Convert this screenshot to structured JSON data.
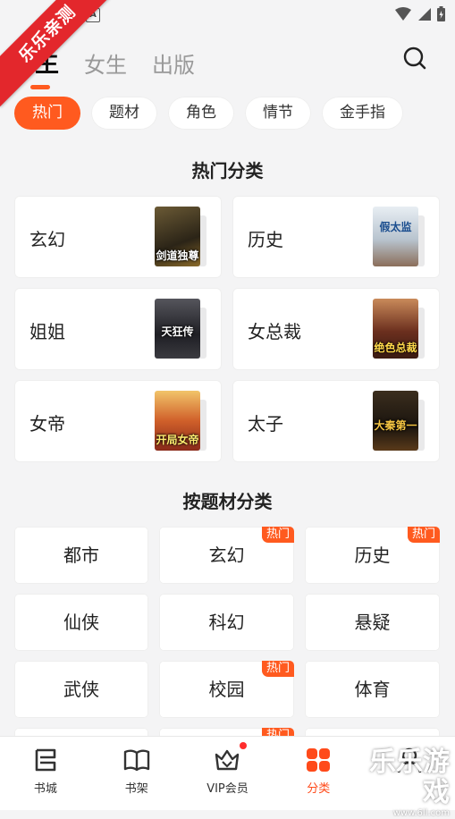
{
  "watermark_ribbon": "乐乐亲测",
  "watermark_corner": {
    "title": "乐乐游戏",
    "url": "www.6ll.com"
  },
  "top_tabs": [
    {
      "label": "男生",
      "active": true
    },
    {
      "label": "女生",
      "active": false
    },
    {
      "label": "出版",
      "active": false
    }
  ],
  "chips": [
    {
      "label": "热门",
      "active": true
    },
    {
      "label": "题材",
      "active": false
    },
    {
      "label": "角色",
      "active": false
    },
    {
      "label": "情节",
      "active": false
    },
    {
      "label": "金手指",
      "active": false
    }
  ],
  "hot_section": {
    "title": "热门分类",
    "items": [
      {
        "label": "玄幻",
        "cover_text": "剑道独尊",
        "cover_color": "#3a3325"
      },
      {
        "label": "历史",
        "cover_text": "假太监",
        "cover_color": "#c8d3dc"
      },
      {
        "label": "姐姐",
        "cover_text": "天狂传",
        "cover_color": "#2c2c30"
      },
      {
        "label": "女总裁",
        "cover_text": "绝色总裁",
        "cover_color": "#5b2a1e"
      },
      {
        "label": "女帝",
        "cover_text": "开局女帝",
        "cover_color": "#b84a22"
      },
      {
        "label": "太子",
        "cover_text": "大秦第一",
        "cover_color": "#2a2118"
      }
    ]
  },
  "genre_section": {
    "title": "按题材分类",
    "badge": "热门",
    "items": [
      {
        "label": "都市",
        "hot": false
      },
      {
        "label": "玄幻",
        "hot": true
      },
      {
        "label": "历史",
        "hot": true
      },
      {
        "label": "仙侠",
        "hot": false
      },
      {
        "label": "科幻",
        "hot": false
      },
      {
        "label": "悬疑",
        "hot": false
      },
      {
        "label": "武侠",
        "hot": false
      },
      {
        "label": "校园",
        "hot": true
      },
      {
        "label": "体育",
        "hot": false
      }
    ]
  },
  "bottom_nav": [
    {
      "label": "书城",
      "icon": "bookstore-icon",
      "active": false
    },
    {
      "label": "书架",
      "icon": "bookshelf-icon",
      "active": false
    },
    {
      "label": "VIP会员",
      "icon": "vip-crown-icon",
      "active": false
    },
    {
      "label": "分类",
      "icon": "category-icon",
      "active": true
    },
    {
      "label": "",
      "icon": "profile-icon",
      "active": false
    }
  ],
  "colors": {
    "accent": "#ff5a1f",
    "nav_active": "#ff4a1a",
    "ribbon": "#e3272c"
  }
}
